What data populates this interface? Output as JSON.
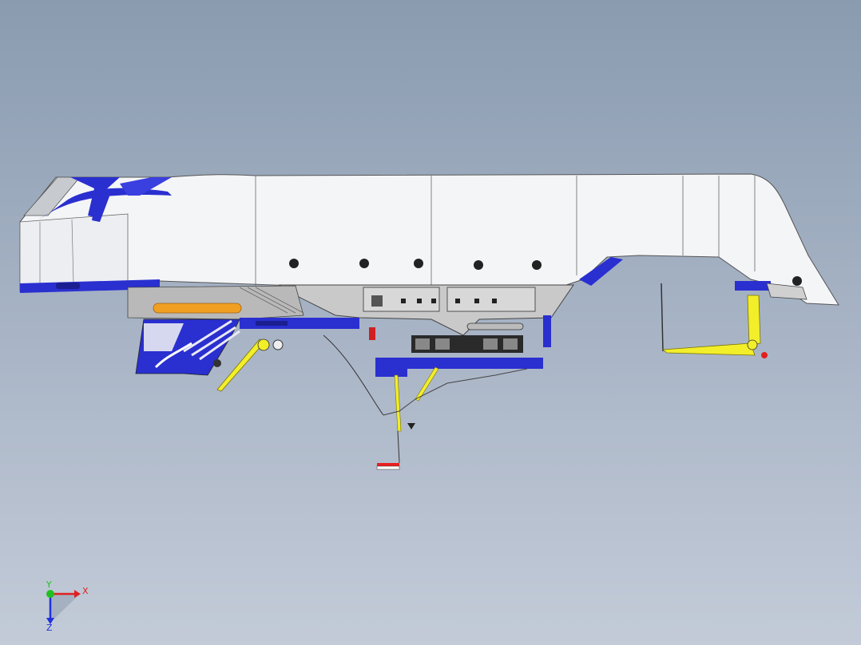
{
  "viewport": {
    "background_top": "#8a9bb0",
    "background_bottom": "#c3cbd8"
  },
  "model": {
    "body_color": "#f4f5f7",
    "accent_color": "#2a2fd0",
    "frame_color": "#c9c9c9",
    "arm_color": "#f2ee2a",
    "tank_color": "#f0a020"
  },
  "triad": {
    "x_label": "X",
    "y_label": "Y",
    "z_label": "Z",
    "x_color": "#e02020",
    "y_color": "#20c020",
    "z_color": "#2030e0"
  }
}
